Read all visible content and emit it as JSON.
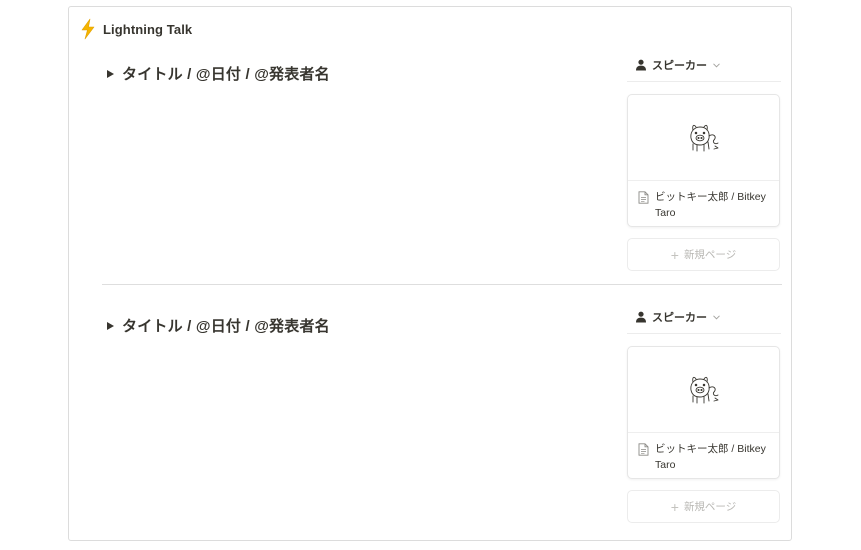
{
  "database": {
    "title": "Lightning Talk",
    "icon": "lightning-bolt-icon",
    "accent_color": "#f5b400"
  },
  "sections": [
    {
      "heading": "タイトル / @日付 / @発表者名",
      "property_label": "スピーカー",
      "card": {
        "cover_icon": "pig-doodle-icon",
        "name": "ビットキー太郎 / Bitkey Taro"
      },
      "new_page_label": "新規ページ"
    },
    {
      "heading": "タイトル / @日付 / @発表者名",
      "property_label": "スピーカー",
      "card": {
        "cover_icon": "pig-doodle-icon",
        "name": "ビットキー太郎 / Bitkey Taro"
      },
      "new_page_label": "新規ページ"
    }
  ]
}
